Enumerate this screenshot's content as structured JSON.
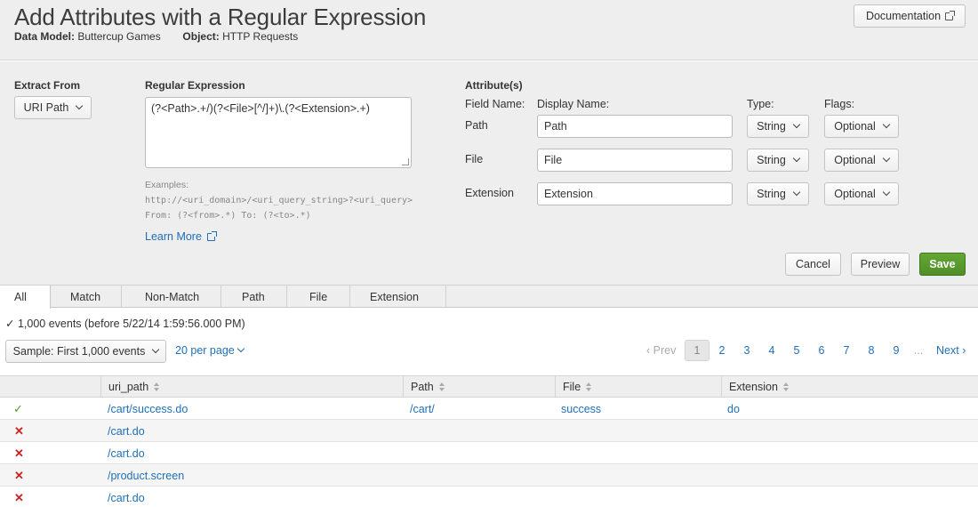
{
  "header": {
    "title": "Add Attributes with a Regular Expression",
    "data_model_label": "Data Model:",
    "data_model_value": "Buttercup Games",
    "object_label": "Object:",
    "object_value": "HTTP Requests",
    "documentation_label": "Documentation"
  },
  "extract": {
    "label": "Extract From",
    "value": "URI Path"
  },
  "regex": {
    "label": "Regular Expression",
    "value": "(?<Path>.+/)(?<File>[^/]+)\\.(?<Extension>.+)",
    "examples_label": "Examples:",
    "example_line1": "http://<uri_domain>/<uri_query_string>?<uri_query>",
    "example_line2": "From: (?<from>.*) To: (?<to>.*)",
    "learn_more": "Learn More"
  },
  "attributes": {
    "label": "Attribute(s)",
    "col_field_name": "Field Name:",
    "col_display_name": "Display Name:",
    "col_type": "Type:",
    "col_flags": "Flags:",
    "rows": [
      {
        "field": "Path",
        "display": "Path",
        "type": "String",
        "flags": "Optional"
      },
      {
        "field": "File",
        "display": "File",
        "type": "String",
        "flags": "Optional"
      },
      {
        "field": "Extension",
        "display": "Extension",
        "type": "String",
        "flags": "Optional"
      }
    ]
  },
  "actions": {
    "cancel": "Cancel",
    "preview": "Preview",
    "save": "Save"
  },
  "tabs": [
    "All",
    "Match",
    "Non-Match",
    "Path",
    "File",
    "Extension"
  ],
  "results": {
    "summary": "1,000 events (before 5/22/14 1:59:56.000 PM)",
    "sample": "Sample: First 1,000 events",
    "per_page": "20 per page",
    "pager": {
      "prev": "Prev",
      "pages": [
        "1",
        "2",
        "3",
        "4",
        "5",
        "6",
        "7",
        "8",
        "9"
      ],
      "ellipsis": "...",
      "next": "Next",
      "current": "1"
    }
  },
  "table": {
    "columns": [
      "uri_path",
      "Path",
      "File",
      "Extension"
    ],
    "rows": [
      {
        "status": "match",
        "status_glyph": "✓",
        "uri_path": "/cart/success.do",
        "path": "/cart/",
        "file": "success",
        "extension": "do"
      },
      {
        "status": "non-match",
        "status_glyph": "✕",
        "uri_path": "/cart.do",
        "path": "",
        "file": "",
        "extension": ""
      },
      {
        "status": "non-match",
        "status_glyph": "✕",
        "uri_path": "/cart.do",
        "path": "",
        "file": "",
        "extension": ""
      },
      {
        "status": "non-match",
        "status_glyph": "✕",
        "uri_path": "/product.screen",
        "path": "",
        "file": "",
        "extension": ""
      },
      {
        "status": "non-match",
        "status_glyph": "✕",
        "uri_path": "/cart.do",
        "path": "",
        "file": "",
        "extension": ""
      }
    ]
  },
  "colors": {
    "accent": "#1e6fb8",
    "save_green": "#5a9e2f",
    "match_green": "#4a9a2c",
    "nonmatch_red": "#cc2222"
  }
}
